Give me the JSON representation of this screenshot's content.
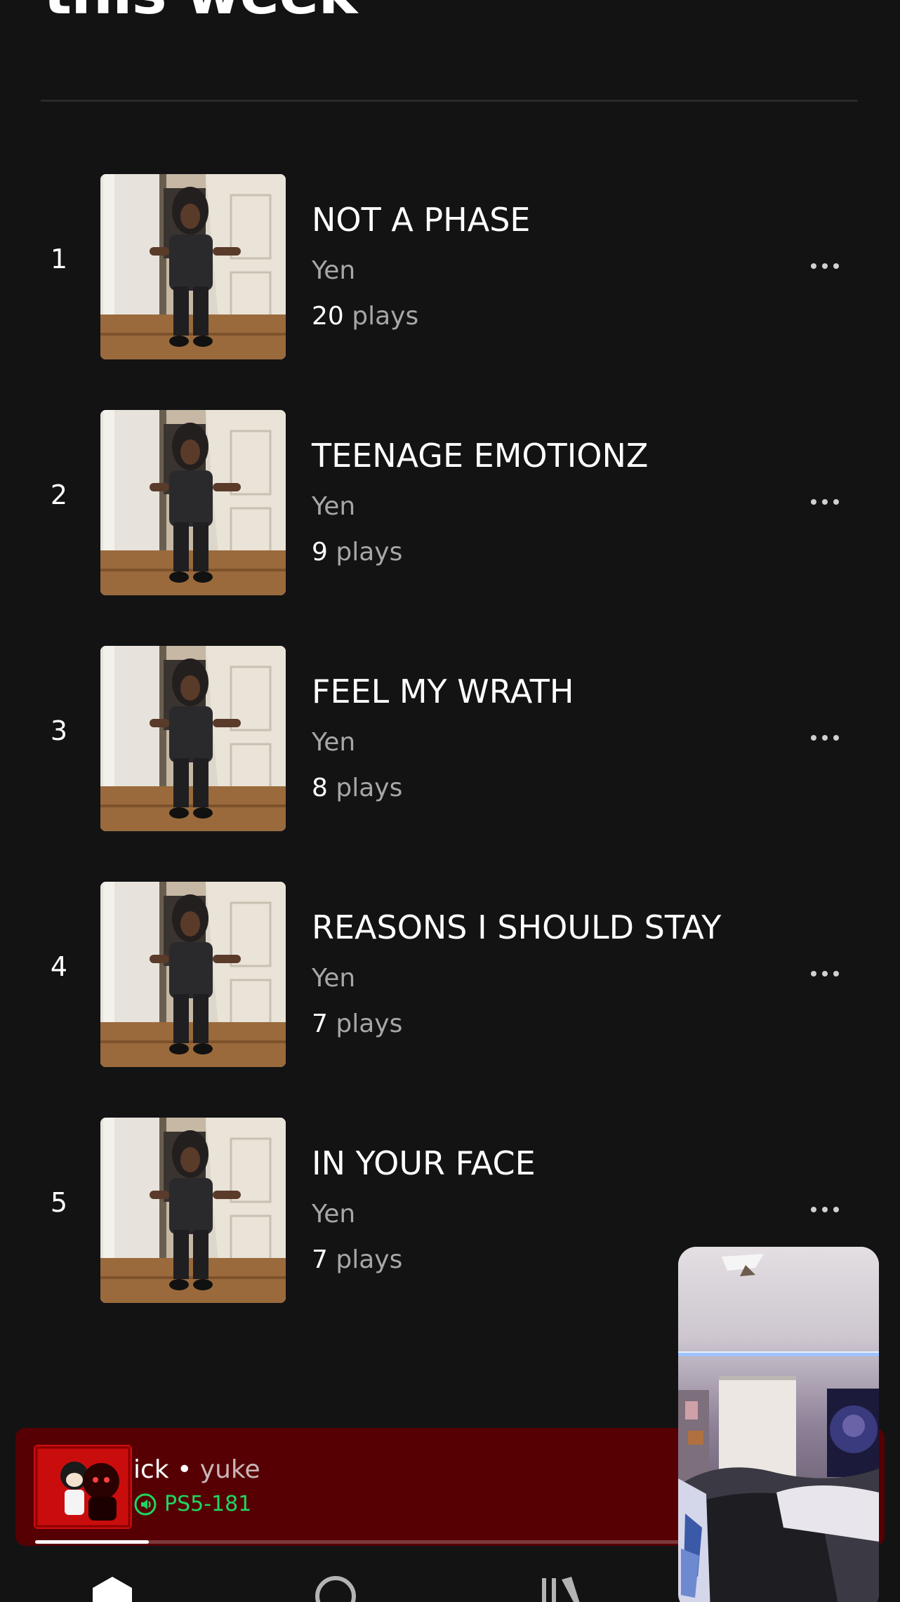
{
  "section": {
    "title": "this week"
  },
  "tracks": [
    {
      "rank": "1",
      "title": "NOT A PHASE",
      "artist": "Yen",
      "plays": "20",
      "plays_unit": "plays"
    },
    {
      "rank": "2",
      "title": "TEENAGE EMOTIONZ",
      "artist": "Yen",
      "plays": "9",
      "plays_unit": "plays"
    },
    {
      "rank": "3",
      "title": "FEEL MY WRATH",
      "artist": "Yen",
      "plays": "8",
      "plays_unit": "plays"
    },
    {
      "rank": "4",
      "title": "REASONS I SHOULD STAY",
      "artist": "Yen",
      "plays": "7",
      "plays_unit": "plays"
    },
    {
      "rank": "5",
      "title": "IN YOUR FACE",
      "artist": "Yen",
      "plays": "7",
      "plays_unit": "plays"
    }
  ],
  "now_playing": {
    "song": "ick",
    "separator": "•",
    "artist": "yuke",
    "device": "PS5-181",
    "progress": 0.137
  },
  "colors": {
    "background": "#131314",
    "mini_player": "#560004",
    "device_accent": "#1ed760",
    "secondary_text": "#a7a7a7"
  },
  "icons": {
    "track_menu": "more-horizontal-icon",
    "device": "speaker-icon",
    "nav": [
      "home-icon",
      "search-icon",
      "library-icon"
    ]
  }
}
